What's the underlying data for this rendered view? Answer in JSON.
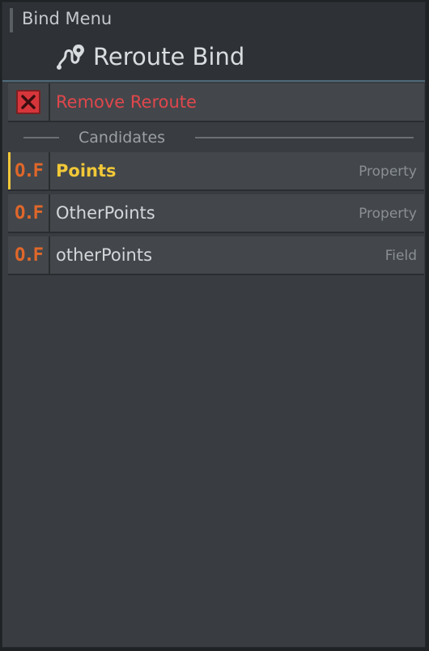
{
  "header": {
    "menu_title": "Bind Menu",
    "bind_title": "Reroute Bind",
    "bind_icon": "reroute-icon"
  },
  "remove": {
    "label": "Remove Reroute",
    "icon": "close-icon"
  },
  "candidates": {
    "title": "Candidates",
    "items": [
      {
        "icon": "O.F",
        "label": "Points",
        "kind": "Property",
        "selected": true
      },
      {
        "icon": "O.F",
        "label": "OtherPoints",
        "kind": "Property",
        "selected": false
      },
      {
        "icon": "O.F",
        "label": "otherPoints",
        "kind": "Field",
        "selected": false
      }
    ]
  },
  "colors": {
    "accent_selected": "#f2c838",
    "remove": "#e0474c",
    "type_icon": "#e0672a",
    "header_border": "#4f6a7a"
  }
}
